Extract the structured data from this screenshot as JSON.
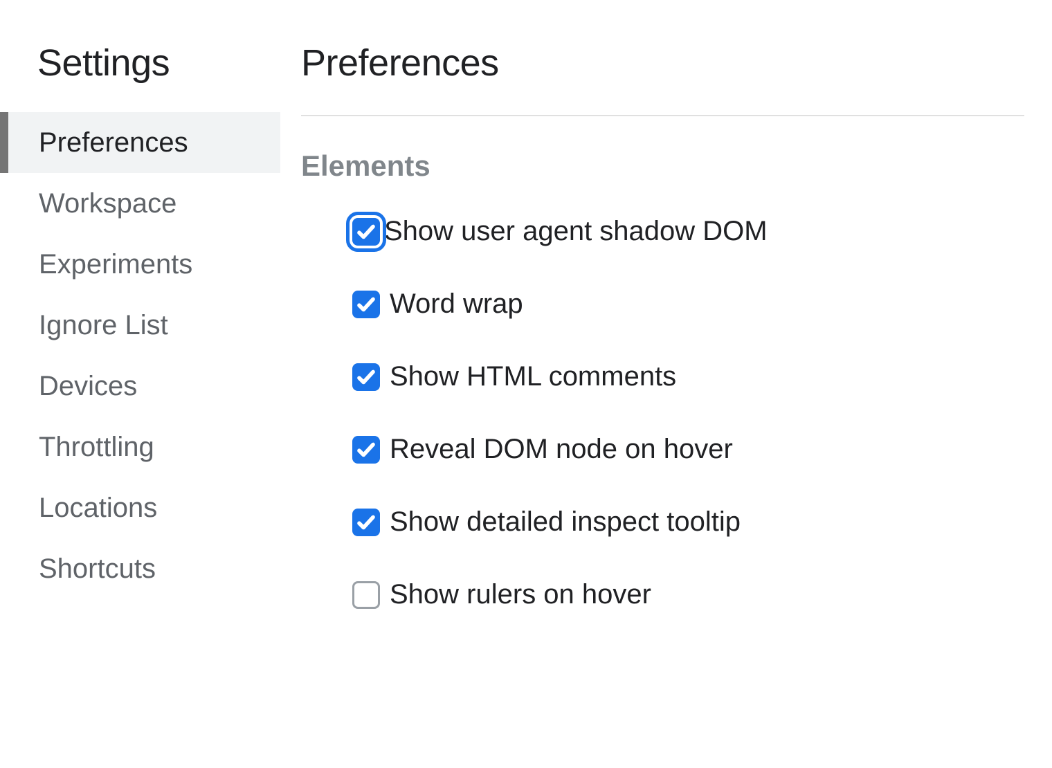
{
  "sidebar": {
    "title": "Settings",
    "items": [
      {
        "label": "Preferences",
        "active": true
      },
      {
        "label": "Workspace",
        "active": false
      },
      {
        "label": "Experiments",
        "active": false
      },
      {
        "label": "Ignore List",
        "active": false
      },
      {
        "label": "Devices",
        "active": false
      },
      {
        "label": "Throttling",
        "active": false
      },
      {
        "label": "Locations",
        "active": false
      },
      {
        "label": "Shortcuts",
        "active": false
      }
    ]
  },
  "main": {
    "title": "Preferences",
    "section": "Elements",
    "options": [
      {
        "label": "Show user agent shadow DOM",
        "checked": true,
        "focused": true
      },
      {
        "label": "Word wrap",
        "checked": true,
        "focused": false
      },
      {
        "label": "Show HTML comments",
        "checked": true,
        "focused": false
      },
      {
        "label": "Reveal DOM node on hover",
        "checked": true,
        "focused": false
      },
      {
        "label": "Show detailed inspect tooltip",
        "checked": true,
        "focused": false
      },
      {
        "label": "Show rulers on hover",
        "checked": false,
        "focused": false
      }
    ]
  }
}
